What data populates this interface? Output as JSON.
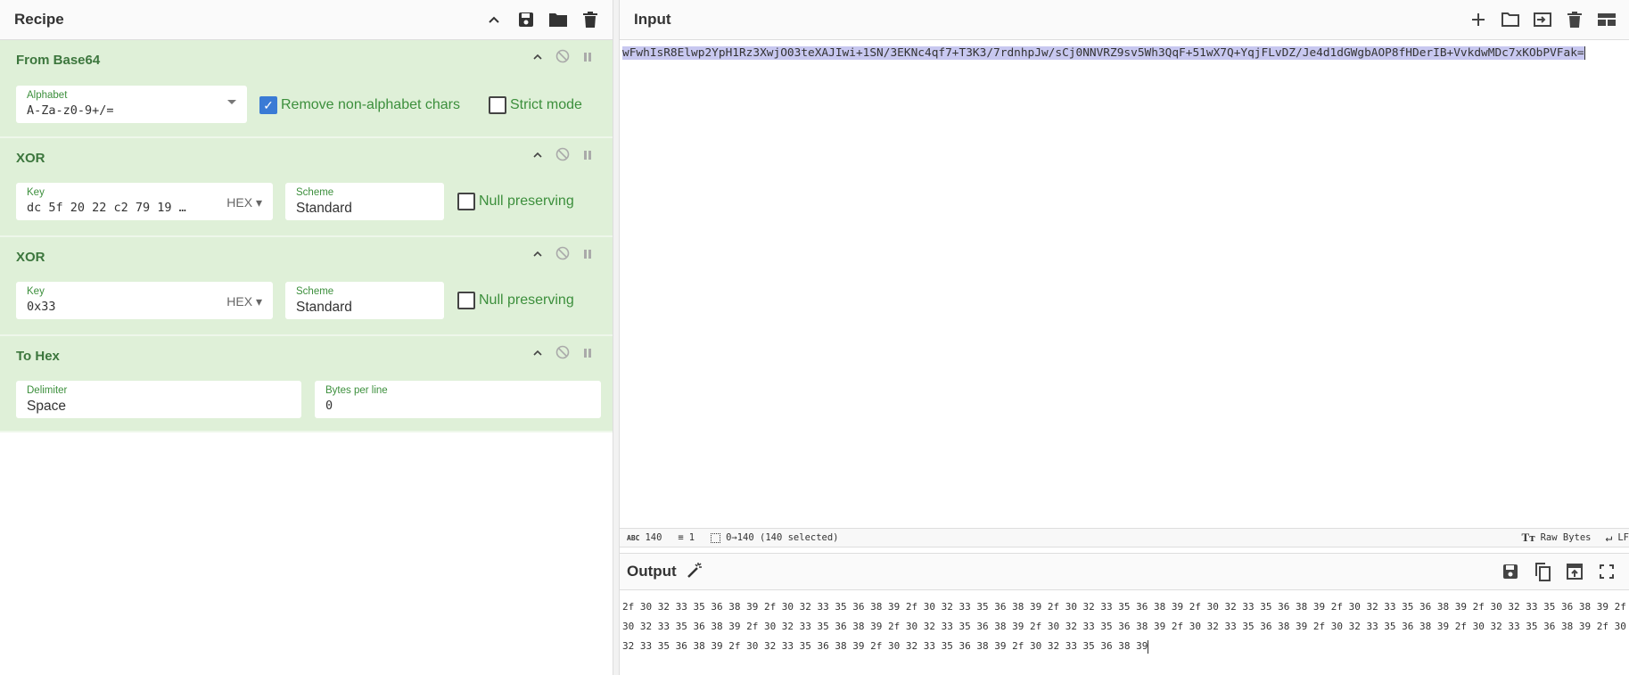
{
  "recipe": {
    "title": "Recipe",
    "ops": [
      {
        "title": "From Base64",
        "alphabet_label": "Alphabet",
        "alphabet_value": "A-Za-z0-9+/=",
        "remove_label": "Remove non-alphabet chars",
        "remove_checked": true,
        "strict_label": "Strict mode"
      },
      {
        "title": "XOR",
        "key_label": "Key",
        "key_value": "dc 5f 20 22 c2 79 19 …",
        "key_format": "HEX",
        "scheme_label": "Scheme",
        "scheme_value": "Standard",
        "null_label": "Null preserving"
      },
      {
        "title": "XOR",
        "key_label": "Key",
        "key_value": "0x33",
        "key_format": "HEX",
        "scheme_label": "Scheme",
        "scheme_value": "Standard",
        "null_label": "Null preserving"
      },
      {
        "title": "To Hex",
        "delim_label": "Delimiter",
        "delim_value": "Space",
        "bpl_label": "Bytes per line",
        "bpl_value": "0"
      }
    ]
  },
  "input": {
    "title": "Input",
    "text": "wFwhIsR8Elwp2YpH1Rz3XwjO03teXAJIwi+1SN/3EKNc4qf7+T3K3/7rdnhpJw/sCj0NNVRZ9sv5Wh3QqF+51wX7Q+YqjFLvDZ/Je4d1dGWgbAOP8fHDerIB+VvkdwMDc7xKObPVFak=",
    "status": {
      "length": "140",
      "lines": "1",
      "selection": "0→140 (140 selected)",
      "encoding": "Raw Bytes",
      "eol": "LF"
    }
  },
  "output": {
    "title": "Output",
    "text": "2f 30 32 33 35 36 38 39 2f 30 32 33 35 36 38 39 2f 30 32 33 35 36 38 39 2f 30 32 33 35 36 38 39 2f 30 32 33 35 36 38 39 2f 30 32 33 35 36 38 39 2f 30 32 33 35 36 38 39 2f 30 32 33 35 36 38 39 2f 30 32 33 35 36 38 39 2f 30 32 33 35 36 38 39 2f 30 32 33 35 36 38 39 2f 30 32 33 35 36 38 39 2f 30 32 33 35 36 38 39 2f 30 32 33 35 36 38 39 2f 30 32 33 35 36 38 39 2f 30 32 33 35 36 38 39 2f 30 32 33 35 36 38 39 2f 30 32 33 35 36 38 39"
  }
}
